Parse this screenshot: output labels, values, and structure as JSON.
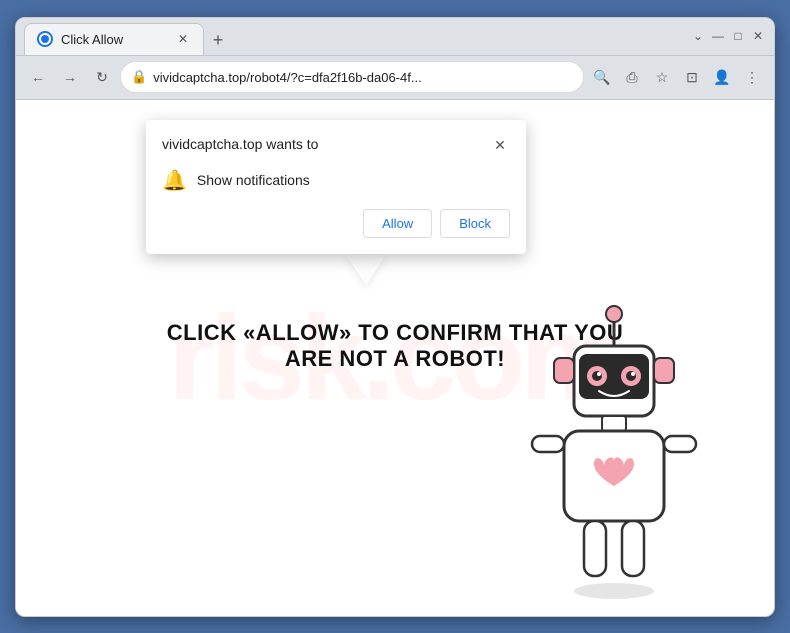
{
  "browser": {
    "tab": {
      "title": "Click Allow",
      "favicon": "globe"
    },
    "new_tab_label": "+",
    "window_controls": {
      "minimize": "—",
      "maximize": "□",
      "close": "✕"
    },
    "nav": {
      "back": "←",
      "forward": "→",
      "refresh": "↻"
    },
    "address_bar": {
      "url": "vividcaptcha.top/robot4/?c=dfa2f16b-da06-4f...",
      "lock_icon": "🔒"
    },
    "address_icons": {
      "search": "🔍",
      "share": "⎙",
      "star": "☆",
      "split": "⊡",
      "account": "👤",
      "menu": "⋮"
    }
  },
  "popup": {
    "title": "vividcaptcha.top wants to",
    "close_icon": "✕",
    "permission_icon": "🔔",
    "permission_text": "Show notifications",
    "allow_label": "Allow",
    "block_label": "Block"
  },
  "page": {
    "captcha_line1": "CLICK «ALLOW» TO CONFIRM THAT YOU",
    "captcha_line2": "ARE NOT A ROBOT!"
  },
  "watermark": {
    "text": "risk.co"
  },
  "colors": {
    "allow_text": "#1a73e8",
    "block_text": "#1a73e8",
    "captcha_text": "#111111",
    "border": "#4a6fa5"
  }
}
